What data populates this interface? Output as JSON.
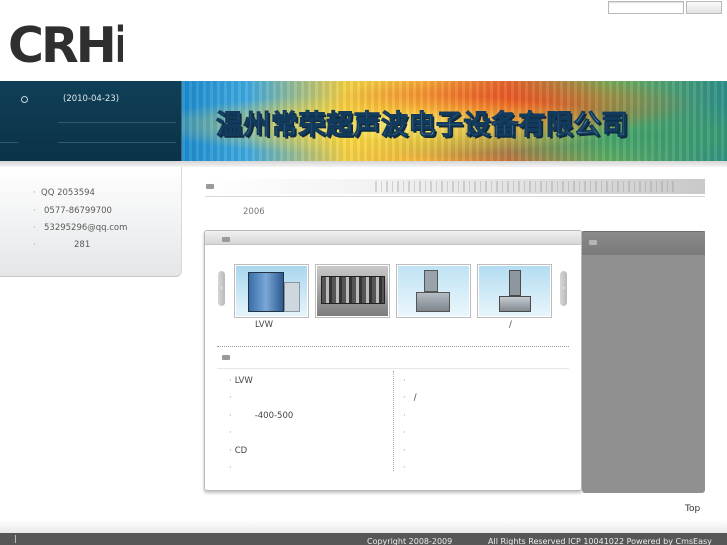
{
  "header": {
    "logo_text": "CRHi",
    "search": {
      "placeholder": "",
      "button_label": ""
    }
  },
  "news": {
    "date": "(2010-04-23)"
  },
  "banner": {
    "title": "温州常荣超声波电子设备有限公司"
  },
  "contact": {
    "items": [
      {
        "bullet": "·",
        "text": "QQ 2053594"
      },
      {
        "bullet": "·",
        "text": "0577-86799700"
      },
      {
        "bullet": "·",
        "text": "53295296@qq.com"
      },
      {
        "bullet": "·",
        "text": "281"
      }
    ]
  },
  "about": {
    "year": "2006"
  },
  "products": {
    "prev_arrow": "‹",
    "next_arrow": "›",
    "captions": [
      "LVW",
      "/"
    ],
    "list_left": [
      {
        "bullet": "·",
        "text": "LVW"
      },
      {
        "bullet": "·",
        "text": ""
      },
      {
        "bullet": "·",
        "text": "-400-500"
      },
      {
        "bullet": "·",
        "text": ""
      },
      {
        "bullet": "·",
        "text": "CD"
      },
      {
        "bullet": "·",
        "text": ""
      }
    ],
    "list_right": [
      {
        "bullet": "·",
        "text": ""
      },
      {
        "bullet": "·",
        "text": "/"
      },
      {
        "bullet": "·",
        "text": ""
      },
      {
        "bullet": "·",
        "text": ""
      },
      {
        "bullet": "·",
        "text": ""
      },
      {
        "bullet": "·",
        "text": ""
      }
    ]
  },
  "footer": {
    "mark": "|",
    "top_link": "Top",
    "copyright": "Copyright 2008-2009",
    "rights": "All Rights Reserved  ICP 10041022  Powered by CmsEasy"
  },
  "colors": {
    "dark_band": "#0f3f57",
    "right_column": "#909090",
    "footer": "#575757"
  },
  "icons": [
    "news-bullet-icon",
    "section-marker-icon",
    "prev-arrow-icon",
    "next-arrow-icon"
  ]
}
